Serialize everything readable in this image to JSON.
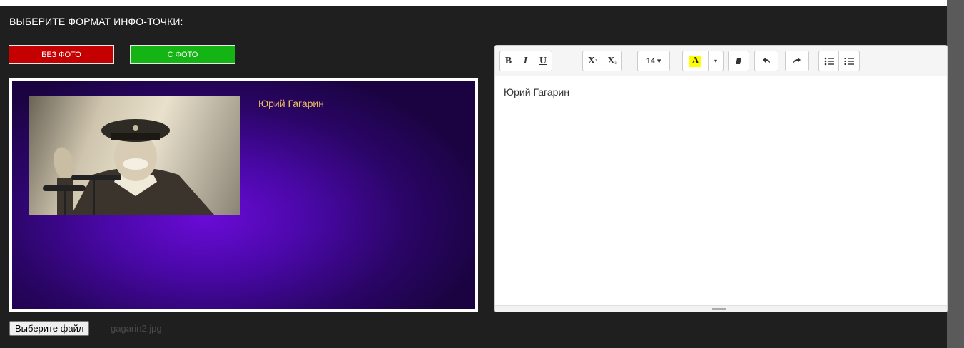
{
  "heading": "ВЫБЕРИТЕ ФОРМАТ ИНФО-ТОЧКИ:",
  "format_buttons": {
    "no_photo_label": "БЕЗ ФОТО",
    "with_photo_label": "С ФОТО"
  },
  "preview": {
    "name_text": "Юрий Гагарин"
  },
  "editor": {
    "toolbar": {
      "bold": "B",
      "italic": "I",
      "underline": "U",
      "superscript": "X",
      "subscript": "X",
      "font_size": "14 ▾",
      "highlight": "A",
      "caret": "▾"
    },
    "content": "Юрий Гагарин"
  },
  "file_input": {
    "button_label": "Выберите файл",
    "file_name": "gagarin2.jpg"
  },
  "colors": {
    "no_photo_button": "#c40000",
    "with_photo_button": "#14b414",
    "name_text": "#f0c060",
    "highlight": "#ffff00"
  }
}
